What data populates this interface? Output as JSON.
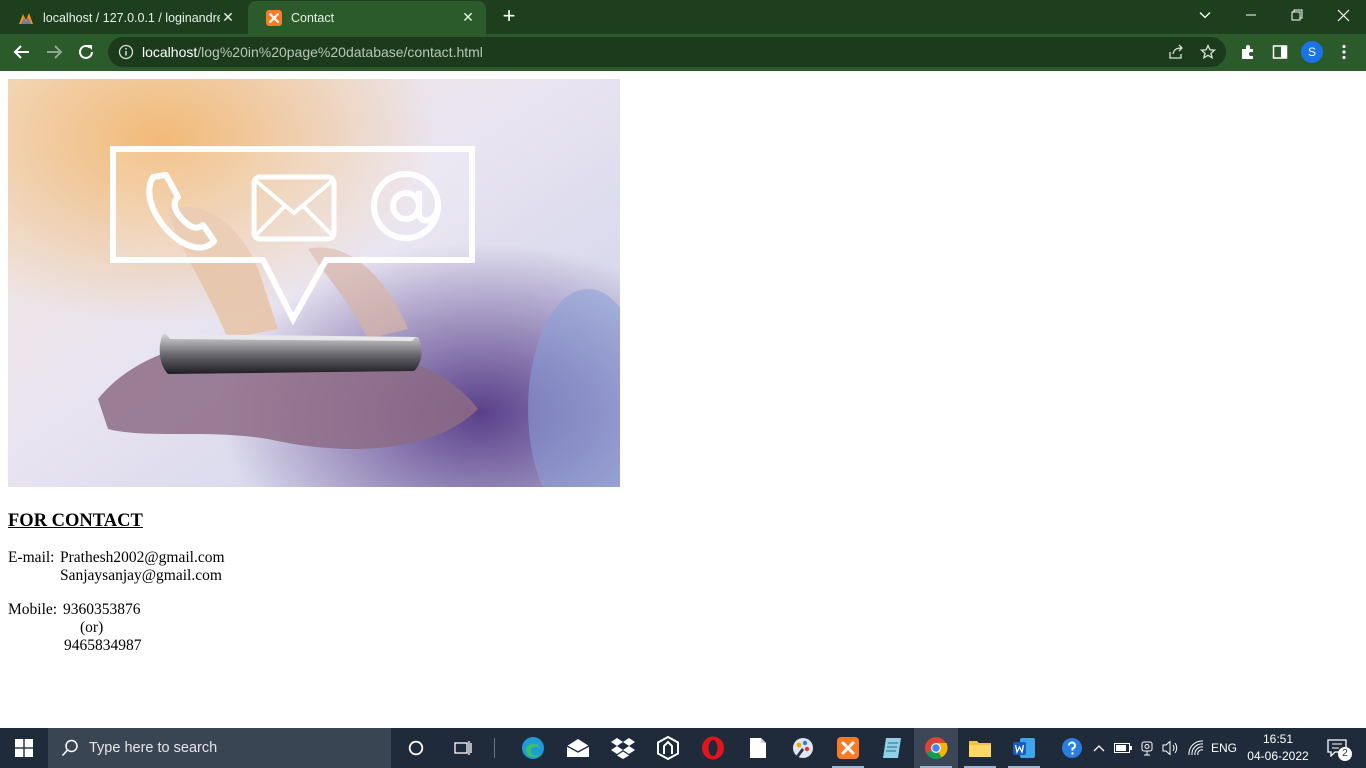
{
  "browser": {
    "tabs": [
      {
        "title": "localhost / 127.0.0.1 / loginandre",
        "close": "✕"
      },
      {
        "title": "Contact",
        "close": "✕"
      }
    ],
    "new_tab": "+",
    "url": {
      "host": "localhost",
      "path": "/log%20in%20page%20database/contact.html"
    },
    "profile_initial": "S"
  },
  "page": {
    "heading": "FOR CONTACT",
    "email_label": "E-mail:",
    "emails": [
      "Prathesh2002@gmail.com",
      "Sanjaysanjay@gmail.com"
    ],
    "mobile_label": "Mobile:",
    "mobiles": [
      "9360353876",
      "9465834987"
    ],
    "separator": "(or)"
  },
  "taskbar": {
    "search_placeholder": "Type here to search",
    "language": "ENG",
    "time": "16:51",
    "date": "04-06-2022",
    "notification_count": "2"
  },
  "colors": {
    "chrome_dark": "#1e3f1e",
    "chrome_toolbar": "#2b5a2b",
    "taskbar": "#1f2b3a",
    "accent_blue": "#1a73e8"
  }
}
